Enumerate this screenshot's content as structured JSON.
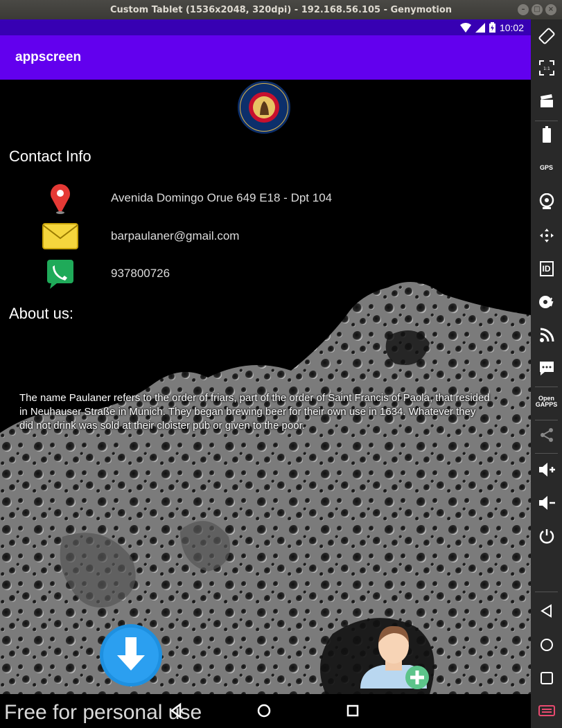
{
  "window": {
    "title": "Custom Tablet (1536x2048, 320dpi) - 192.168.56.105 - Genymotion"
  },
  "statusbar": {
    "time": "10:02"
  },
  "app": {
    "title": "appscreen"
  },
  "logo": {
    "top_text": "PAULANER",
    "bottom_text": "MÜNCHEN"
  },
  "contact": {
    "heading": "Contact Info",
    "address": "Avenida Domingo Orue 649 E18 - Dpt 104",
    "email": "barpaulaner@gmail.com",
    "phone": "937800726"
  },
  "about": {
    "heading": "About us:",
    "text": "The name Paulaner refers to the order of friars, part of the order of Saint Francis of Paola, that resided in Neuhauser Straße in Munich. They began brewing beer for their own use in 1634. Whatever they did not drink was sold at their cloister pub or given to the poor."
  },
  "watermark": "Free for personal use",
  "sidebar": {
    "gps_label": "GPS",
    "id_label": "ID",
    "open_gapps_label_1": "Open",
    "open_gapps_label_2": "GAPPS"
  },
  "icons": {
    "location": "location-pin-icon",
    "email": "envelope-icon",
    "phone": "phone-icon",
    "download": "download-arrow-icon",
    "add_user": "add-user-icon"
  },
  "colors": {
    "statusbar": "#3700b3",
    "appbar": "#6200ee",
    "background": "#000000",
    "fab_download": "#1e90e0"
  }
}
